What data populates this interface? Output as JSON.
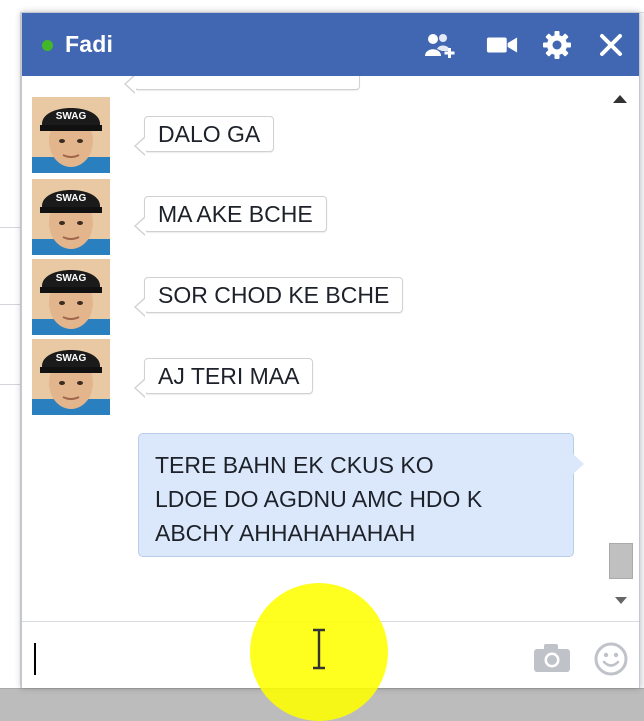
{
  "chat": {
    "contact_name": "Fadi",
    "status": "online",
    "colors": {
      "header": "#4267b2",
      "online": "#42b72a",
      "mine_bubble": "#dbe8fb"
    },
    "header_icons": [
      "add-friend-icon",
      "video-call-icon",
      "gear-icon",
      "close-icon"
    ],
    "messages": [
      {
        "sender": "Fadi",
        "text": "DALO GA"
      },
      {
        "sender": "Fadi",
        "text": "MA AKE BCHE"
      },
      {
        "sender": "Fadi",
        "text": "SOR CHOD KE BCHE"
      },
      {
        "sender": "Fadi",
        "text": "AJ TERI MAA"
      }
    ],
    "my_message": {
      "lines": [
        "TERE BAHN EK CKUS KO",
        "LDOE DO AGDNU AMC HDO K",
        "ABCHY AHHAHAHAHAH"
      ]
    },
    "composer": {
      "value": "",
      "icons": [
        "camera-icon",
        "emoji-icon"
      ]
    }
  }
}
